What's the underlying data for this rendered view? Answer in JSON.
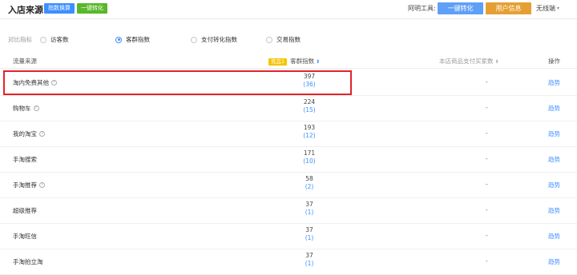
{
  "header": {
    "title": "入店来源",
    "btn_index_convert": "指数换算",
    "btn_one_click": "一键转化",
    "tools_label": "阿明工具:",
    "tool_convert": "一键转化",
    "tool_user_info": "用户信息",
    "no_line": "无线端"
  },
  "compare": {
    "label": "对比指标",
    "options": [
      "访客数",
      "客群指数",
      "支付转化指数",
      "交易指数"
    ],
    "selected": "客群指数"
  },
  "table": {
    "col_source": "流量来源",
    "col_badge": "竞品1",
    "col_metric": "客群指数",
    "col_buyers": "本店商品支付买家数",
    "col_action": "操作",
    "rows": [
      {
        "source": "淘内免费其他",
        "help": true,
        "value": "397",
        "sub": "(36)",
        "buyers": "-",
        "action": "趋势"
      },
      {
        "source": "购物车",
        "help": true,
        "value": "224",
        "sub": "(15)",
        "buyers": "-",
        "action": "趋势"
      },
      {
        "source": "我的淘宝",
        "help": true,
        "value": "193",
        "sub": "(12)",
        "buyers": "-",
        "action": "趋势"
      },
      {
        "source": "手淘搜索",
        "help": false,
        "value": "171",
        "sub": "(10)",
        "buyers": "-",
        "action": "趋势"
      },
      {
        "source": "手淘推荐",
        "help": true,
        "value": "58",
        "sub": "(2)",
        "buyers": "-",
        "action": "趋势"
      },
      {
        "source": "超级推荐",
        "help": false,
        "value": "37",
        "sub": "(1)",
        "buyers": "-",
        "action": "趋势"
      },
      {
        "source": "手淘旺信",
        "help": false,
        "value": "37",
        "sub": "(1)",
        "buyers": "-",
        "action": "趋势"
      },
      {
        "source": "手淘拍立淘",
        "help": false,
        "value": "37",
        "sub": "(1)",
        "buyers": "-",
        "action": "趋势"
      }
    ]
  },
  "colors": {
    "accent": "#3d8fff",
    "green": "#58b82a",
    "orange": "#e5a034",
    "highlight": "#e4232b",
    "badge": "#f5c400"
  }
}
